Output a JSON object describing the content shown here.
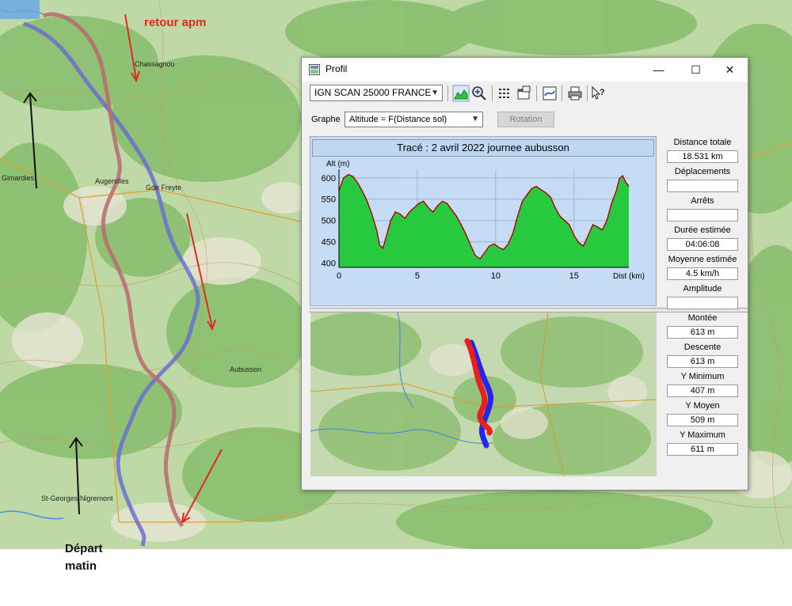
{
  "background": {
    "annotation_retour": "retour apm",
    "annotation_depart_line1": "Départ",
    "annotation_depart_line2": "matin",
    "place_labels": [
      "Augerolles",
      "St-Georges-Nigremont",
      "Gimardies",
      "Gde Freyte",
      "Aubusson",
      "Chassagnou"
    ],
    "track_colors": {
      "blue": "#6b6fd0",
      "red": "#b86a70",
      "arrow_red": "#e02a1f",
      "arrow_black": "#111111"
    }
  },
  "window": {
    "title": "Profil",
    "controls": {
      "minimize": "—",
      "maximize": "☐",
      "close": "✕"
    },
    "toolbar": {
      "map_select_value": "IGN SCAN 25000 FRANCE",
      "icons": [
        "profile-graph-icon",
        "zoom-icon",
        "list-icon",
        "properties-icon",
        "export-icon",
        "print-icon",
        "help-icon"
      ]
    },
    "graphe_label": "Graphe",
    "graphe_select_value": "Altitude = F(Distance sol)",
    "rotation_label": "Rotation",
    "trace_title": "Tracé : 2 avril 2022 journee aubusson",
    "stats": [
      {
        "label": "Distance totale",
        "value": "18.531 km"
      },
      {
        "label": "Déplacements",
        "value": ""
      },
      {
        "label": "Arrêts",
        "value": ""
      },
      {
        "label": "Durée estimée",
        "value": "04:06:08"
      },
      {
        "label": "Moyenne estimée",
        "value": "4.5 km/h"
      },
      {
        "label": "Amplitude",
        "value": ""
      },
      {
        "label": "Montée",
        "value": "613 m"
      },
      {
        "label": "Descente",
        "value": "613 m"
      },
      {
        "label": "Y Minimum",
        "value": "407 m"
      },
      {
        "label": "Y Moyen",
        "value": "509 m"
      },
      {
        "label": "Y Maximum",
        "value": "611 m"
      }
    ]
  },
  "chart_data": {
    "type": "area",
    "title": "",
    "xlabel": "Dist (km)",
    "ylabel": "Alt (m)",
    "xlim": [
      0,
      18.5
    ],
    "ylim": [
      390,
      620
    ],
    "x_ticks": [
      0,
      5,
      10,
      15
    ],
    "y_ticks": [
      400,
      450,
      500,
      550,
      600
    ],
    "grid": true,
    "fill_color": "#27c93f",
    "line_color": "#b00000",
    "series": [
      {
        "x": [
          0,
          0.3,
          0.6,
          0.9,
          1.2,
          1.5,
          1.8,
          2.1,
          2.4,
          2.6,
          2.8,
          3.0,
          3.3,
          3.6,
          3.9,
          4.2,
          4.5,
          4.8,
          5.1,
          5.4,
          5.7,
          6.0,
          6.3,
          6.6,
          6.9,
          7.2,
          7.5,
          7.8,
          8.1,
          8.4,
          8.7,
          9.0,
          9.3,
          9.6,
          9.9,
          10.2,
          10.5,
          10.8,
          11.1,
          11.4,
          11.7,
          12.0,
          12.3,
          12.6,
          12.9,
          13.2,
          13.5,
          13.8,
          14.1,
          14.4,
          14.7,
          15.0,
          15.3,
          15.6,
          15.9,
          16.2,
          16.5,
          16.8,
          17.1,
          17.4,
          17.7,
          17.9,
          18.1,
          18.3,
          18.5
        ],
        "y": [
          570,
          600,
          608,
          603,
          588,
          568,
          545,
          515,
          478,
          442,
          435,
          460,
          500,
          520,
          515,
          505,
          520,
          530,
          540,
          545,
          530,
          520,
          535,
          545,
          540,
          525,
          510,
          490,
          468,
          442,
          418,
          410,
          425,
          440,
          445,
          437,
          432,
          445,
          470,
          510,
          545,
          560,
          575,
          580,
          572,
          565,
          555,
          530,
          510,
          500,
          490,
          465,
          448,
          440,
          465,
          490,
          485,
          478,
          500,
          540,
          570,
          598,
          605,
          590,
          580
        ]
      }
    ]
  }
}
